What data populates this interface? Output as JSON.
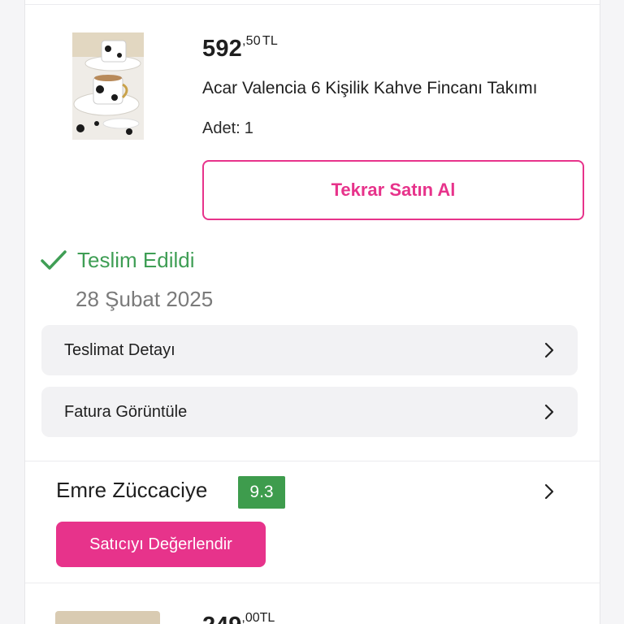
{
  "order_item": {
    "price_main": "592",
    "price_fraction": ",50",
    "currency": "TL",
    "title": "Acar Valencia 6 Kişilik Kahve Fincanı Takımı",
    "quantity_label": "Adet:",
    "quantity_value": "1",
    "buy_again_label": "Tekrar Satın Al",
    "image_icon": "product-photo-cups"
  },
  "delivery": {
    "status_text": "Teslim Edildi",
    "status_color": "#3f9e55",
    "date": "28 Şubat 2025",
    "detail_label": "Teslimat Detayı",
    "invoice_label": "Fatura Görüntüle"
  },
  "seller": {
    "name": "Emre Züccaciye",
    "score": "9.3",
    "score_color": "#3e9c4d",
    "rate_button_label": "Satıcıyı Değerlendir"
  },
  "next_item": {
    "price_main": "249",
    "price_fraction": ",00",
    "currency": "TL"
  },
  "colors": {
    "accent": "#e7338b"
  }
}
